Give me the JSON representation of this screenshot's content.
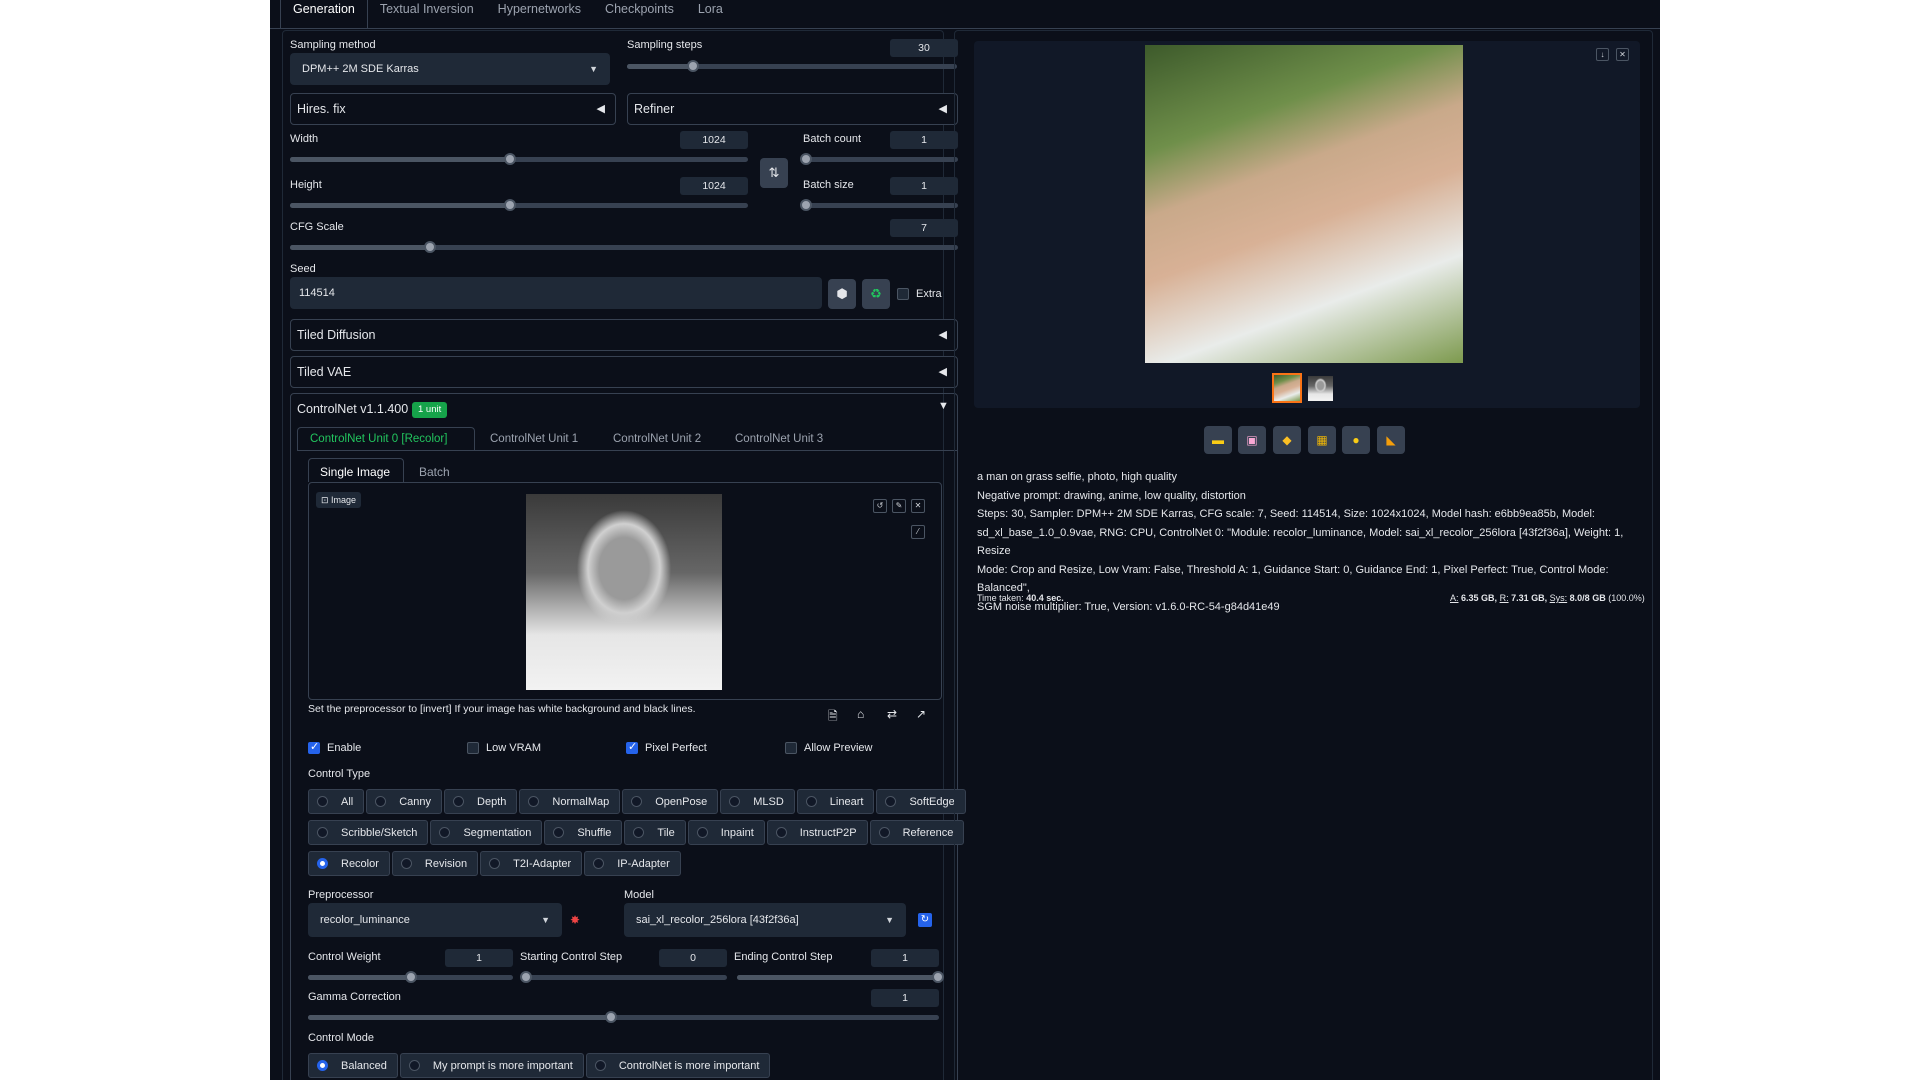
{
  "tabs": [
    "Generation",
    "Textual Inversion",
    "Hypernetworks",
    "Checkpoints",
    "Lora"
  ],
  "sampling": {
    "method_label": "Sampling method",
    "method_value": "DPM++ 2M SDE Karras",
    "steps_label": "Sampling steps",
    "steps_value": "30",
    "steps_fraction": 0.2
  },
  "hires_fix": "Hires. fix",
  "refiner": "Refiner",
  "width": {
    "label": "Width",
    "value": "1024",
    "fraction": 0.48
  },
  "height": {
    "label": "Height",
    "value": "1024",
    "fraction": 0.48
  },
  "batch_count": {
    "label": "Batch count",
    "value": "1",
    "fraction": 0.0
  },
  "batch_size": {
    "label": "Batch size",
    "value": "1",
    "fraction": 0.0
  },
  "cfg": {
    "label": "CFG Scale",
    "value": "7",
    "fraction": 0.21
  },
  "seed": {
    "label": "Seed",
    "value": "114514",
    "extra_label": "Extra"
  },
  "tiled_diffusion": "Tiled Diffusion",
  "tiled_vae": "Tiled VAE",
  "controlnet": {
    "title": "ControlNet v1.1.400",
    "badge": "1 unit",
    "units": [
      "ControlNet Unit 0 [Recolor]",
      "ControlNet Unit 1",
      "ControlNet Unit 2",
      "ControlNet Unit 3"
    ],
    "mode_tabs": [
      "Single Image",
      "Batch"
    ],
    "image_label": "Image",
    "hint": "Set the preprocessor to [invert] If your image has white background and black lines.",
    "enable": "Enable",
    "low_vram": "Low VRAM",
    "pixel_perfect": "Pixel Perfect",
    "allow_preview": "Allow Preview",
    "control_type_label": "Control Type",
    "control_types_row1": [
      "All",
      "Canny",
      "Depth",
      "NormalMap",
      "OpenPose",
      "MLSD",
      "Lineart",
      "SoftEdge"
    ],
    "control_types_row2": [
      "Scribble/Sketch",
      "Segmentation",
      "Shuffle",
      "Tile",
      "Inpaint",
      "InstructP2P",
      "Reference"
    ],
    "control_types_row3": [
      "Recolor",
      "Revision",
      "T2I-Adapter",
      "IP-Adapter"
    ],
    "selected_type": "Recolor",
    "preprocessor_label": "Preprocessor",
    "preprocessor_value": "recolor_luminance",
    "model_label": "Model",
    "model_value": "sai_xl_recolor_256lora [43f2f36a]",
    "control_weight": {
      "label": "Control Weight",
      "value": "1",
      "fraction": 0.5
    },
    "starting_step": {
      "label": "Starting Control Step",
      "value": "0",
      "fraction": 0.0
    },
    "ending_step": {
      "label": "Ending Control Step",
      "value": "1",
      "fraction": 1.0
    },
    "gamma": {
      "label": "Gamma Correction",
      "value": "1",
      "fraction": 0.48
    },
    "control_mode_label": "Control Mode",
    "control_modes": [
      "Balanced",
      "My prompt is more important",
      "ControlNet is more important"
    ]
  },
  "output": {
    "prompt": "a man on grass selfie, photo, high quality",
    "negative": "Negative prompt: drawing, anime, low quality, distortion",
    "params_1": "Steps: 30, Sampler: DPM++ 2M SDE Karras, CFG scale: 7, Seed: 114514, Size: 1024x1024, Model hash: e6bb9ea85b, Model:",
    "params_2": "sd_xl_base_1.0_0.9vae, RNG: CPU, ControlNet 0: \"Module: recolor_luminance, Model: sai_xl_recolor_256lora [43f2f36a], Weight: 1, Resize",
    "params_3": "Mode: Crop and Resize, Low Vram: False, Threshold A: 1, Guidance Start: 0, Guidance End: 1, Pixel Perfect: True, Control Mode: Balanced\",",
    "params_4": "SGM noise multiplier: True, Version: v1.6.0-RC-54-g84d41e49",
    "time_label": "Time taken:",
    "time_value": "40.4 sec.",
    "mem_a_label": "A:",
    "mem_a": "6.35 GB,",
    "mem_r_label": "R:",
    "mem_r": "7.31 GB,",
    "mem_sys_label": "Sys:",
    "mem_sys": "8.0/8 GB",
    "mem_pct": "(100.0%)"
  },
  "colors": {
    "background": "#0b0f19",
    "accent": "#2563eb",
    "badge": "#16a34a",
    "active_unit": "#22c55e"
  }
}
